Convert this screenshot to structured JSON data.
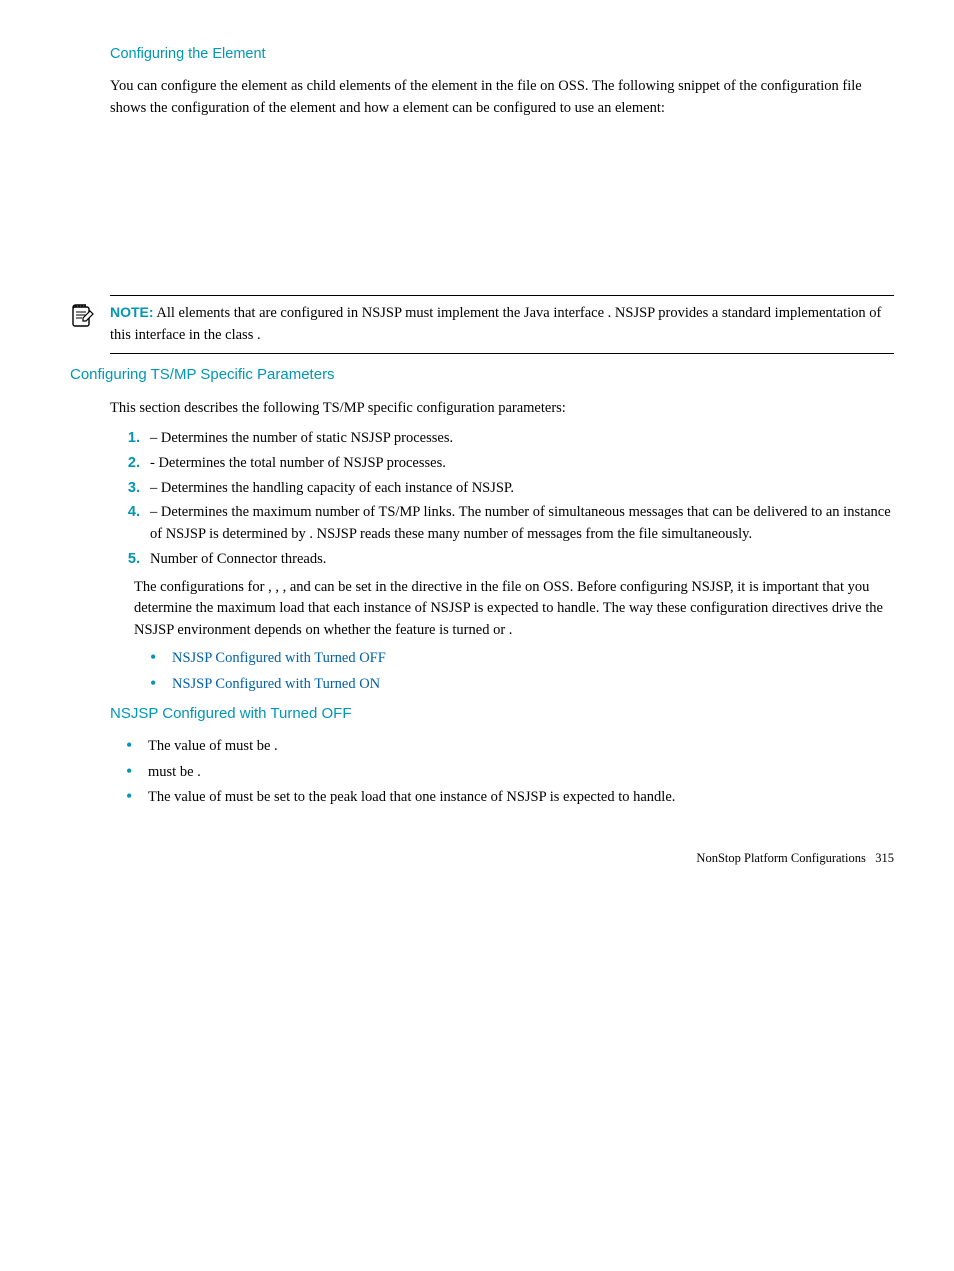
{
  "h_elem": {
    "title_prefix": "Configuring the ",
    "title_suffix": " Element",
    "p1a": "You can configure the ",
    "p1b": " element as child elements of the ",
    "p1c": " element in the ",
    "p1d": " file on OSS. The following snippet of the ",
    "p1e": " configuration file shows the configuration of the ",
    "p1f": " element and how a ",
    "p1g": " element can be configured to use an ",
    "p1h": " element:"
  },
  "note": {
    "label": "NOTE:",
    "t1": "  All ",
    "t2": " elements that are configured in NSJSP must implement the Java interface ",
    "t3": ". NSJSP provides a standard implementation of this interface in the class ",
    "t4": "."
  },
  "tsmp": {
    "title": "Configuring TS/MP Specific Parameters",
    "intro": "This section describes the following TS/MP specific configuration parameters:",
    "li1a": " – Determines the number of static NSJSP processes.",
    "li2a": " - Determines the total number of NSJSP processes.",
    "li3a": " – Determines the handling capacity of each instance of NSJSP.",
    "li4a": " – Determines the maximum number of TS/MP links. The number of simultaneous messages that can be delivered to an instance of NSJSP is determined by ",
    "li4b": ". NSJSP reads these many number of messages from the ",
    "li4c": " file simultaneously.",
    "li5": "Number of Connector threads.",
    "pcfg1": "The configurations for ",
    "comma": ", ",
    "andw": ", and ",
    "pcfg2": " can be set in the ",
    "pcfg3": " directive in the ",
    "pcfg4": " file on OSS. Before configuring NSJSP, it is important that you determine the maximum load that each instance of NSJSP is expected to handle. The way these configuration directives drive the NSJSP environment depends on whether the ",
    "pcfg5": " feature is turned ",
    "or": " or ",
    "dot": ".",
    "link1a": "NSJSP Configured with ",
    "link1b": " Turned OFF",
    "link2a": "NSJSP Configured with ",
    "link2b": " Turned ON"
  },
  "off": {
    "title_a": "NSJSP Configured with ",
    "title_b": " Turned OFF",
    "b1a": "The value of ",
    "b1b": " must be ",
    "b1c": ".",
    "b2a": " must be ",
    "b2b": ".",
    "b3a": "The value of ",
    "b3b": " must be set to the peak load that one instance of NSJSP is expected to handle."
  },
  "footer": {
    "text": "NonStop Platform Configurations",
    "page": "315"
  }
}
